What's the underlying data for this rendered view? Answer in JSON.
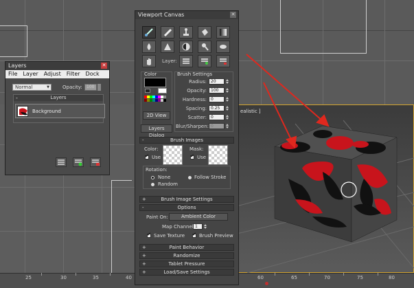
{
  "viewport": {
    "perspective_label": "ealistic ]",
    "ruler_ticks": [
      "25",
      "30",
      "35",
      "40",
      "60",
      "65",
      "70",
      "75",
      "80"
    ]
  },
  "layers_panel": {
    "title": "Layers",
    "menu": [
      "File",
      "Layer",
      "Adjust",
      "Filter",
      "Dock"
    ],
    "blend_mode": "Normal",
    "opacity_label": "Opacity:",
    "opacity_value": "100",
    "group_title": "Layers",
    "layer_name": "Background"
  },
  "canvas_panel": {
    "title": "Viewport Canvas",
    "layer_label": "Layer:",
    "color_group": "Color",
    "view_2d": "2D View",
    "layers_dialog": "Layers Dialog",
    "brush_settings": {
      "title": "Brush Settings",
      "rows": [
        {
          "label": "Radius:",
          "value": "20"
        },
        {
          "label": "Opacity:",
          "value": "100"
        },
        {
          "label": "Hardness:",
          "value": "0"
        },
        {
          "label": "Spacing:",
          "value": "0.25"
        },
        {
          "label": "Scatter:",
          "value": "0"
        },
        {
          "label": "Blur/Sharpen:",
          "value": "0"
        }
      ]
    },
    "brush_images": {
      "title": "Brush Images",
      "color_label": "Color:",
      "mask_label": "Mask:",
      "use_label": "Use",
      "rotation_label": "Rotation:",
      "rotation_options": [
        "None",
        "Follow Stroke",
        "Random"
      ]
    },
    "brush_image_settings": "Brush Image Settings",
    "options": {
      "title": "Options",
      "paint_on_label": "Paint On:",
      "paint_on_value": "Ambient Color",
      "map_channel_label": "Map Channel:",
      "map_channel_value": "1",
      "save_texture": "Save Texture",
      "brush_preview": "Brush Preview"
    },
    "collapsed_sections": [
      "Paint Behavior",
      "Randomize",
      "Tablet Pressure",
      "Load/Save Settings"
    ]
  },
  "colors": {
    "arrow": "#e0281e",
    "paint_red": "#c8141c",
    "viewport_border": "#d4a530"
  }
}
